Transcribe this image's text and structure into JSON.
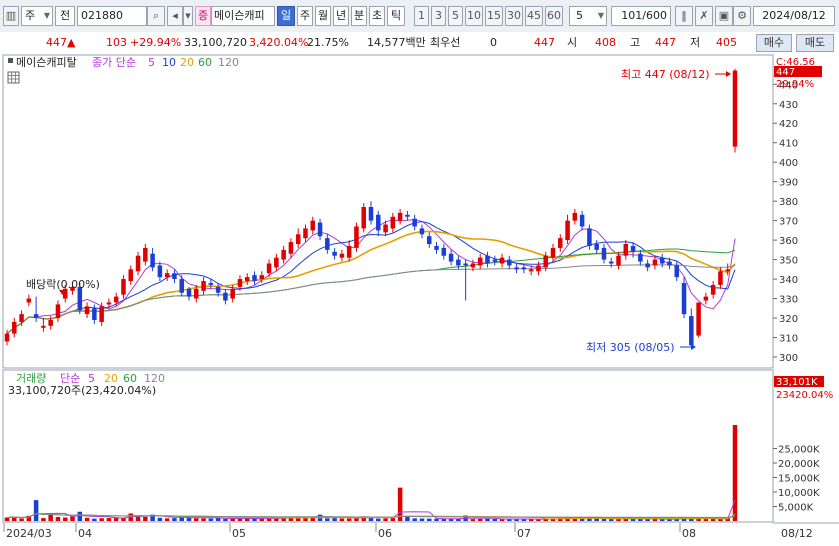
{
  "toolbar": {
    "type_label": "주",
    "prev_label": "전",
    "code": "021880",
    "name_badge": "증",
    "stock_name": "메이슨캐피",
    "periods": [
      "일",
      "주",
      "월",
      "년",
      "분",
      "초",
      "틱"
    ],
    "active_period": "일",
    "intervals": [
      "1",
      "3",
      "5",
      "10",
      "15",
      "30",
      "45",
      "60"
    ],
    "interval_value": "5",
    "count": "101",
    "count_total": "/600",
    "date": "2024/08/12"
  },
  "quote": {
    "price": "447",
    "change": "103",
    "change_pct": "+29.94%",
    "volume": "33,100,720",
    "volume_ratio": "3,420.04%",
    "turnover_rate": "21.75%",
    "amount": "14,577백만",
    "best_ask_label": "최우선",
    "best_ask_value": "0",
    "best_bid_value": "447",
    "open_label": "시",
    "open": "408",
    "high_label": "고",
    "high": "447",
    "low_label": "저",
    "low": "405",
    "buy_label": "매수",
    "sell_label": "매도"
  },
  "price_panel": {
    "name": "메이슨캐피탈",
    "ma_label": "종가 단순",
    "ma_periods": [
      "5",
      "10",
      "20",
      "60",
      "120"
    ],
    "right_top_label": "C:46.56",
    "current_price_tag": "447",
    "current_change_tag": "29.94%",
    "dividend_label": "배당락(0.00%)",
    "high_annotation": "최고 447 (08/12)",
    "low_annotation": "최저 305 (08/05)"
  },
  "volume_panel": {
    "title": "거래량",
    "ma_label": "단순",
    "ma_periods": [
      "5",
      "20",
      "60",
      "120"
    ],
    "volume_info": "33,100,720주(23,420.04%)",
    "current_volume_tag": "33,101K",
    "current_pct_tag": "23420.04%"
  },
  "x_axis": {
    "date_labels": [
      "2024/03",
      "04",
      "05",
      "06",
      "07",
      "08"
    ],
    "current_date_label": "08/12"
  },
  "colors": {
    "up": "#e10000",
    "down": "#1a3fd6",
    "ma5": "#b53ad9",
    "ma10": "#1a3fd6",
    "ma20": "#e6a100",
    "ma60": "#2e9e3a",
    "ma120": "#888888"
  },
  "chart_data": [
    {
      "type": "candlestick",
      "title": "메이슨캐피탈",
      "ylim": [
        295,
        455
      ],
      "y_ticks": [
        300,
        310,
        320,
        330,
        340,
        350,
        360,
        370,
        380,
        390,
        400,
        410,
        420,
        430,
        440
      ],
      "series_open": [
        308,
        312,
        318,
        328,
        322,
        315,
        316,
        320,
        330,
        334,
        336,
        322,
        325,
        318,
        327,
        328,
        332,
        339,
        344,
        349,
        353,
        347,
        341,
        343,
        340,
        335,
        330,
        334,
        338,
        336,
        333,
        330,
        336,
        339,
        342,
        340,
        343,
        346,
        350,
        353,
        358,
        361,
        365,
        369,
        361,
        354,
        351,
        351,
        356,
        366,
        377,
        373,
        364,
        366,
        370,
        373,
        371,
        366,
        362,
        357,
        356,
        353,
        350,
        348,
        346,
        347,
        352,
        350,
        348,
        350,
        346,
        346,
        344,
        344,
        346,
        351,
        356,
        360,
        370,
        373,
        366,
        358,
        356,
        349,
        347,
        352,
        357,
        353,
        348,
        347,
        351,
        349,
        347,
        338,
        321,
        311,
        329,
        332,
        337,
        344,
        408
      ],
      "series_close": [
        312,
        318,
        322,
        330,
        320,
        316,
        319,
        327,
        335,
        336,
        324,
        326,
        319,
        326,
        328,
        331,
        340,
        345,
        352,
        356,
        346,
        341,
        343,
        340,
        333,
        331,
        335,
        339,
        337,
        333,
        329,
        335,
        340,
        341,
        339,
        342,
        348,
        351,
        355,
        359,
        363,
        366,
        370,
        362,
        355,
        352,
        353,
        357,
        367,
        377,
        370,
        365,
        368,
        372,
        374,
        372,
        367,
        363,
        358,
        355,
        352,
        349,
        347,
        347,
        348,
        351,
        348,
        349,
        351,
        347,
        345,
        345,
        345,
        347,
        352,
        356,
        361,
        370,
        374,
        367,
        357,
        355,
        350,
        348,
        352,
        358,
        354,
        349,
        346,
        350,
        348,
        347,
        341,
        322,
        306,
        328,
        331,
        337,
        344,
        345,
        447
      ],
      "series_high": [
        314,
        320,
        324,
        332,
        331,
        320,
        321,
        329,
        337,
        338,
        338,
        328,
        327,
        328,
        330,
        333,
        342,
        347,
        354,
        358,
        356,
        349,
        345,
        345,
        342,
        336,
        337,
        341,
        340,
        338,
        335,
        337,
        342,
        343,
        344,
        344,
        350,
        353,
        357,
        361,
        366,
        368,
        372,
        371,
        363,
        356,
        355,
        360,
        369,
        379,
        380,
        375,
        370,
        374,
        376,
        375,
        373,
        368,
        364,
        359,
        358,
        355,
        352,
        350,
        350,
        353,
        354,
        352,
        353,
        352,
        348,
        348,
        347,
        349,
        354,
        358,
        363,
        373,
        376,
        375,
        368,
        360,
        358,
        351,
        354,
        360,
        359,
        355,
        350,
        352,
        353,
        351,
        349,
        341,
        325,
        313,
        333,
        339,
        346,
        348,
        448
      ],
      "series_low": [
        306,
        310,
        316,
        326,
        318,
        313,
        314,
        318,
        328,
        332,
        322,
        320,
        317,
        316,
        325,
        326,
        330,
        337,
        342,
        347,
        344,
        339,
        339,
        338,
        331,
        329,
        328,
        332,
        335,
        331,
        327,
        328,
        334,
        337,
        337,
        338,
        341,
        344,
        348,
        351,
        356,
        359,
        363,
        360,
        353,
        350,
        349,
        349,
        354,
        364,
        368,
        362,
        362,
        364,
        368,
        370,
        365,
        361,
        356,
        353,
        350,
        347,
        345,
        329,
        344,
        345,
        346,
        347,
        346,
        345,
        343,
        343,
        342,
        342,
        344,
        349,
        354,
        358,
        368,
        365,
        355,
        353,
        348,
        346,
        345,
        350,
        351,
        347,
        344,
        345,
        346,
        345,
        339,
        320,
        305,
        310,
        327,
        330,
        335,
        342,
        405
      ]
    },
    {
      "type": "bar",
      "title": "거래량",
      "ylim": [
        0,
        35000
      ],
      "y_ticks": [
        5000,
        10000,
        15000,
        20000,
        25000
      ],
      "values": [
        1200,
        1500,
        900,
        1800,
        7200,
        1000,
        2100,
        1400,
        1200,
        1700,
        3200,
        1100,
        800,
        950,
        1000,
        1300,
        1200,
        2600,
        1600,
        1400,
        2200,
        1100,
        900,
        1000,
        1400,
        1500,
        950,
        900,
        850,
        1100,
        700,
        800,
        1100,
        900,
        850,
        800,
        950,
        1000,
        1200,
        1400,
        1600,
        1300,
        1500,
        2200,
        900,
        1100,
        850,
        900,
        1300,
        1600,
        1200,
        800,
        900,
        1000,
        11500,
        1500,
        900,
        850,
        800,
        750,
        700,
        850,
        700,
        1900,
        650,
        700,
        750,
        700,
        650,
        600,
        700,
        800,
        650,
        600,
        700,
        900,
        1000,
        1400,
        1300,
        1200,
        900,
        850,
        700,
        650,
        750,
        900,
        800,
        700,
        650,
        700,
        650,
        600,
        700,
        1200,
        900,
        800,
        650,
        700,
        850,
        900,
        33101
      ]
    }
  ]
}
